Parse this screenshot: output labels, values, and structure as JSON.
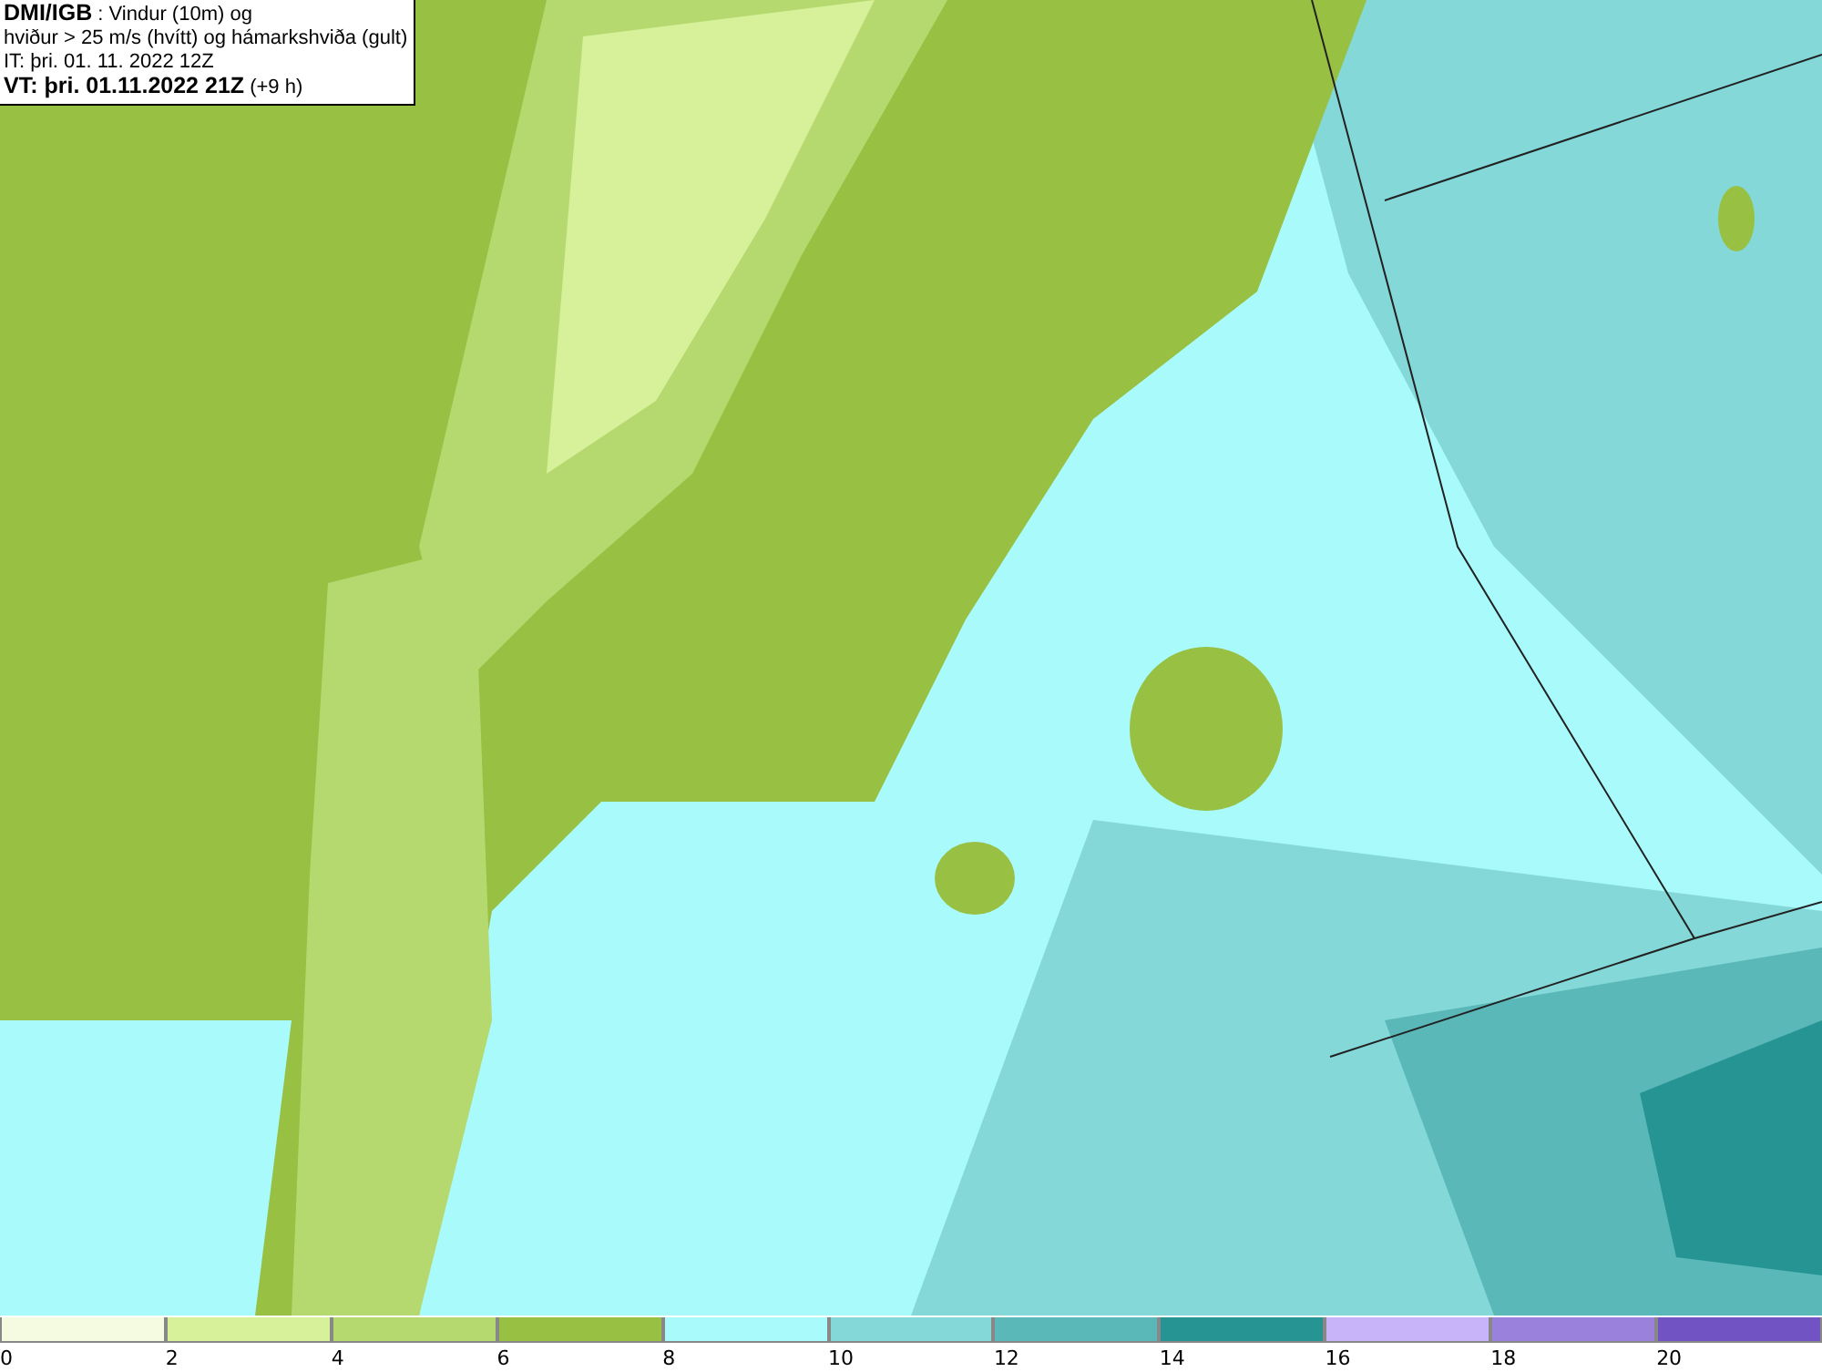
{
  "title_box": {
    "lines": [
      "**DMI/IGB** : Vindur (10m) og",
      "hviður > 25 m/s (hvítt) og hámarkshviða (gult)",
      "IT: þri. 01. 11. 2022 12Z",
      "**VT: þri. 01.11.2022 21Z** (+9 h)"
    ]
  },
  "legend": {
    "bins": [
      {
        "label": "0",
        "color": "#f4fbe0"
      },
      {
        "label": "2",
        "color": "#d7f09a"
      },
      {
        "label": "4",
        "color": "#b5d96f"
      },
      {
        "label": "6",
        "color": "#98c043"
      },
      {
        "label": "8",
        "color": "#a9fbfb"
      },
      {
        "label": "10",
        "color": "#84d8d8"
      },
      {
        "label": "12",
        "color": "#5ab8b8"
      },
      {
        "label": "14",
        "color": "#279494"
      },
      {
        "label": "16",
        "color": "#c8b4f8"
      },
      {
        "label": "18",
        "color": "#9a82dc"
      },
      {
        "label": "20",
        "color": "#7153c4"
      }
    ]
  }
}
